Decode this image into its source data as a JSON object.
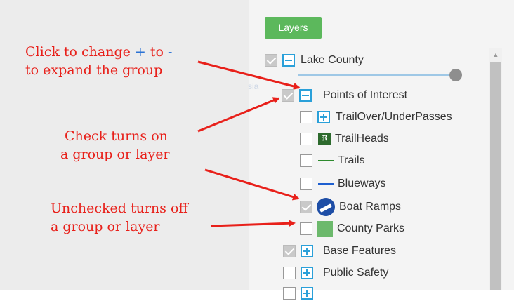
{
  "annotations": {
    "expand_line1_prefix": "Click to change ",
    "expand_plus": "+",
    "expand_mid": " to ",
    "expand_minus": "-",
    "expand_line2": "to expand the group",
    "check_line1": "Check turns on",
    "check_line2": "a group or layer",
    "uncheck_line1": "Unchecked turns off",
    "uncheck_line2": "a group or layer"
  },
  "panel": {
    "button_label": "Layers",
    "map_label": "sia"
  },
  "layers": [
    {
      "label": "Lake County",
      "checked": true,
      "toggle": "minus",
      "icon": "none"
    },
    {
      "label": "Points of Interest",
      "checked": true,
      "toggle": "minus",
      "icon": "none"
    },
    {
      "label": "TrailOver/UnderPasses",
      "checked": false,
      "toggle": "plus",
      "icon": "none"
    },
    {
      "label": "TrailHeads",
      "checked": false,
      "toggle": "none",
      "icon": "trailhead-icon"
    },
    {
      "label": "Trails",
      "checked": false,
      "toggle": "none",
      "icon": "green-line-icon"
    },
    {
      "label": "Blueways",
      "checked": false,
      "toggle": "none",
      "icon": "blue-line-icon"
    },
    {
      "label": "Boat Ramps",
      "checked": true,
      "toggle": "none",
      "icon": "boat-ramp-icon"
    },
    {
      "label": "County Parks",
      "checked": false,
      "toggle": "none",
      "icon": "county-park-icon"
    },
    {
      "label": "Base Features",
      "checked": true,
      "toggle": "plus",
      "icon": "none"
    },
    {
      "label": "Public Safety",
      "checked": false,
      "toggle": "plus",
      "icon": "none"
    }
  ],
  "colors": {
    "annotation": "#e8201a",
    "accent_blue": "#2aa0d9",
    "button_green": "#5cb85c",
    "trail_green": "#2d8a2d",
    "blueway_blue": "#1e5fd0"
  }
}
